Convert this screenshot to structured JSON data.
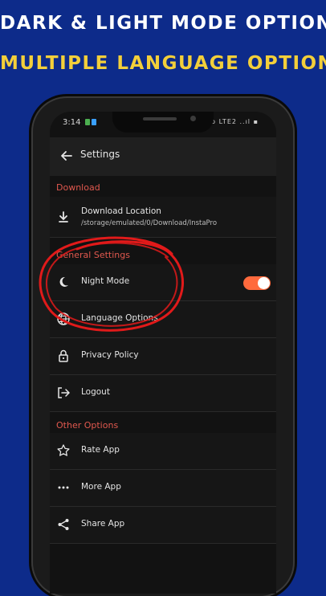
{
  "banner": {
    "line1": "DARK & LIGHT MODE OPTION",
    "line2": "MULTIPLE LANGUAGE OPTION"
  },
  "statusbar": {
    "time": "3:14",
    "indicators": "Vo LTE2 ..ıl ▪"
  },
  "appbar": {
    "back_icon": "arrow-left-icon",
    "title": "Settings"
  },
  "sections": {
    "download": {
      "label": "Download",
      "items": [
        {
          "icon": "download-icon",
          "title": "Download Location",
          "subtitle": "/storage/emulated/0/Download/InstaPro"
        }
      ]
    },
    "general": {
      "label": "General Settings",
      "items": [
        {
          "icon": "moon-icon",
          "title": "Night Mode",
          "toggle_on": true
        },
        {
          "icon": "globe-icon",
          "title": "Language Options"
        },
        {
          "icon": "lock-icon",
          "title": "Privacy Policy"
        },
        {
          "icon": "logout-icon",
          "title": "Logout"
        }
      ]
    },
    "other": {
      "label": "Other Options",
      "items": [
        {
          "icon": "star-icon",
          "title": "Rate App"
        },
        {
          "icon": "more-dots-icon",
          "title": "More App"
        },
        {
          "icon": "share-icon",
          "title": "Share App"
        }
      ]
    }
  },
  "colors": {
    "background": "#0d2b8a",
    "headline_yellow": "#f3cf3a",
    "accent_red": "#e0584e",
    "toggle_orange": "#ff6a3d",
    "annotation_red": "#e11a1a"
  }
}
